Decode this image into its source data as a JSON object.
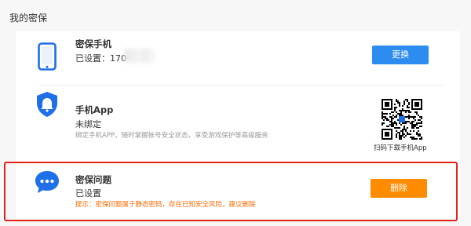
{
  "page": {
    "title": "我的密保"
  },
  "items": {
    "phone": {
      "icon": "smartphone-icon",
      "title": "密保手机",
      "status": "已设置：170",
      "button": "更换"
    },
    "app": {
      "icon": "shield-icon",
      "title": "手机App",
      "status": "未绑定",
      "description": "绑定手机APP，随时掌握帐号安全状态，享受游戏保护等高级服务",
      "qr_label": "扫码下载手机App"
    },
    "question": {
      "icon": "chat-bubble-icon",
      "title": "密保问题",
      "status": "已设置",
      "tip": "提示：密保问题属于静态密码，存在已知安全风险，建议删除",
      "button": "删除"
    }
  },
  "colors": {
    "primary_button": "#2d8cf0",
    "warning_button": "#ff8c00",
    "tip_text": "#ff6a00",
    "icon_blue": "#1e6fe8",
    "highlight_border": "#e2231a"
  }
}
